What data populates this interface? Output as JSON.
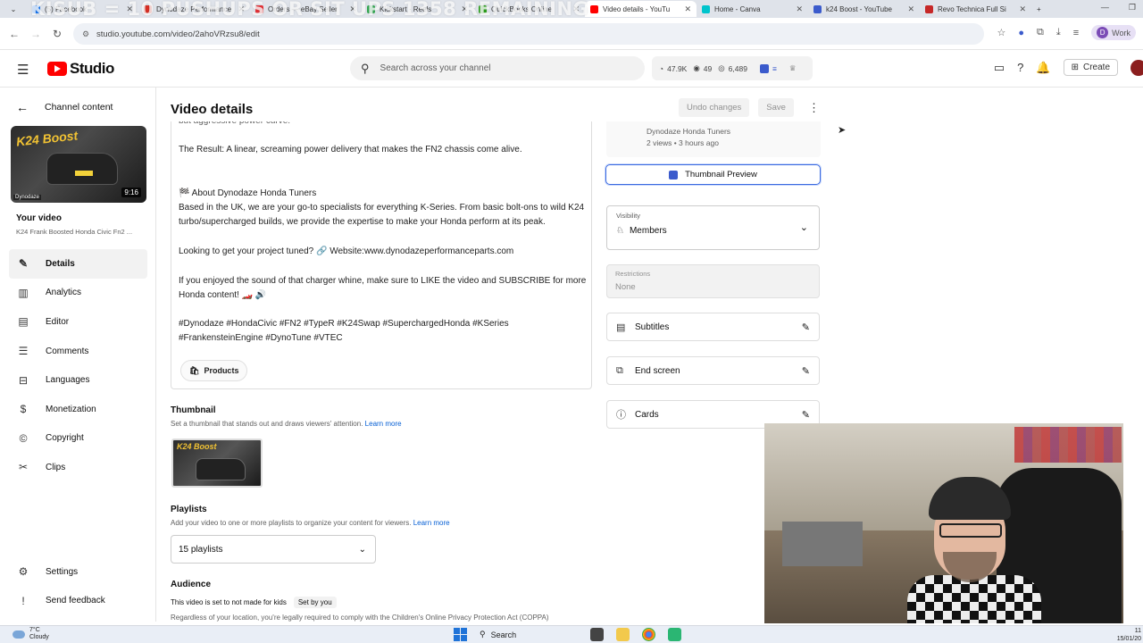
{
  "overlay_text": "KISUB = 10 PUSHUPS OR SIT UPS 1358 REMAINING",
  "browser": {
    "tabs": [
      {
        "label": "(5) Facebook",
        "color": "#1877f2",
        "active": false
      },
      {
        "label": "Dynodaze Performance",
        "color": "#d93025",
        "active": false
      },
      {
        "label": "Orders — eBay Seller",
        "color": "#e53238",
        "active": false
      },
      {
        "label": "Kickstart · Reels",
        "color": "#34a853",
        "active": false
      },
      {
        "label": "QuickBooks Online",
        "color": "#2ca01c",
        "active": false
      },
      {
        "label": "Video details - YouTu",
        "color": "#ff0000",
        "active": true
      },
      {
        "label": "Home - Canva",
        "color": "#00c4cc",
        "active": false
      },
      {
        "label": "k24 Boost - YouTube",
        "color": "#3b5bcc",
        "active": false
      },
      {
        "label": "Revo Technica Full Si",
        "color": "#c62828",
        "active": false
      }
    ],
    "url": "studio.youtube.com/video/2ahoVRzsu8/edit",
    "profile_label": "Work",
    "profile_initial": "D"
  },
  "studio": {
    "logo_text": "Studio",
    "search_placeholder": "Search across your channel",
    "stats": {
      "views": "47.9K",
      "likes": "49",
      "subs": "6,489"
    },
    "create_label": "Create"
  },
  "sidebar": {
    "back_label": "Channel content",
    "duration": "9:16",
    "thumb_title": "K24 Boost",
    "thumb_brand": "Dynodaze",
    "your_video_label": "Your video",
    "video_title": "K24 Frank Boosted Honda Civic Fn2 ...",
    "items": [
      {
        "label": "Details",
        "icon": "✎",
        "active": true
      },
      {
        "label": "Analytics",
        "icon": "▥",
        "active": false
      },
      {
        "label": "Editor",
        "icon": "▤",
        "active": false
      },
      {
        "label": "Comments",
        "icon": "☰",
        "active": false
      },
      {
        "label": "Languages",
        "icon": "⊟",
        "active": false
      },
      {
        "label": "Monetization",
        "icon": "$",
        "active": false
      },
      {
        "label": "Copyright",
        "icon": "©",
        "active": false
      },
      {
        "label": "Clips",
        "icon": "✂",
        "active": false
      }
    ],
    "bottom_items": [
      {
        "label": "Settings",
        "icon": "⚙"
      },
      {
        "label": "Send feedback",
        "icon": "!"
      }
    ]
  },
  "main": {
    "title": "Video details",
    "undo_label": "Undo changes",
    "save_label": "Save",
    "description": {
      "line_curve": "but aggressive power curve.",
      "line_result": "The Result: A linear, screaming power delivery that makes the FN2 chassis come alive.",
      "line_about": "🏁 About Dynodaze Honda Tuners",
      "line_based": "Based in the UK, we are your go-to specialists for everything K-Series. From basic bolt-ons to wild K24 turbo/supercharged builds, we provide the expertise to make your Honda perform at its peak.",
      "line_tuned": "Looking to get your project tuned? 🔗 Website:www.dynodazeperformanceparts.com",
      "line_enjoyed": "If you enjoyed the sound of that charger whine, make sure to LIKE the video and SUBSCRIBE for more Honda content! 🏎️ 🔊",
      "line_tags": "#Dynodaze #HondaCivic #FN2 #TypeR #K24Swap #SuperchargedHonda #KSeries #FrankensteinEngine #DynoTune #VTEC"
    },
    "products_label": "Products",
    "thumbnail": {
      "title": "Thumbnail",
      "sub": "Set a thumbnail that stands out and draws viewers' attention.",
      "learn_more": "Learn more",
      "thumb_text": "K24 Boost"
    },
    "playlists": {
      "title": "Playlists",
      "sub": "Add your video to one or more playlists to organize your content for viewers.",
      "learn_more": "Learn more",
      "value": "15 playlists"
    },
    "audience": {
      "title": "Audience",
      "status": "This video is set to not made for kids",
      "set_by": "Set by you",
      "coppa": "Regardless of your location, you're legally required to comply with the Children's Online Privacy Protection Act (COPPA)"
    }
  },
  "right": {
    "channel": "Dynodaze Honda Tuners",
    "views_time": "2 views • 3 hours ago",
    "thumbnail_preview_label": "Thumbnail Preview",
    "visibility_label": "Visibility",
    "visibility_value": "Members",
    "restrictions_label": "Restrictions",
    "restrictions_value": "None",
    "subtitles_label": "Subtitles",
    "end_screen_label": "End screen",
    "cards_label": "Cards"
  },
  "taskbar": {
    "temp": "7°C",
    "weather": "Cloudy",
    "search_label": "Search",
    "time": "11",
    "date": "15/01/20"
  }
}
